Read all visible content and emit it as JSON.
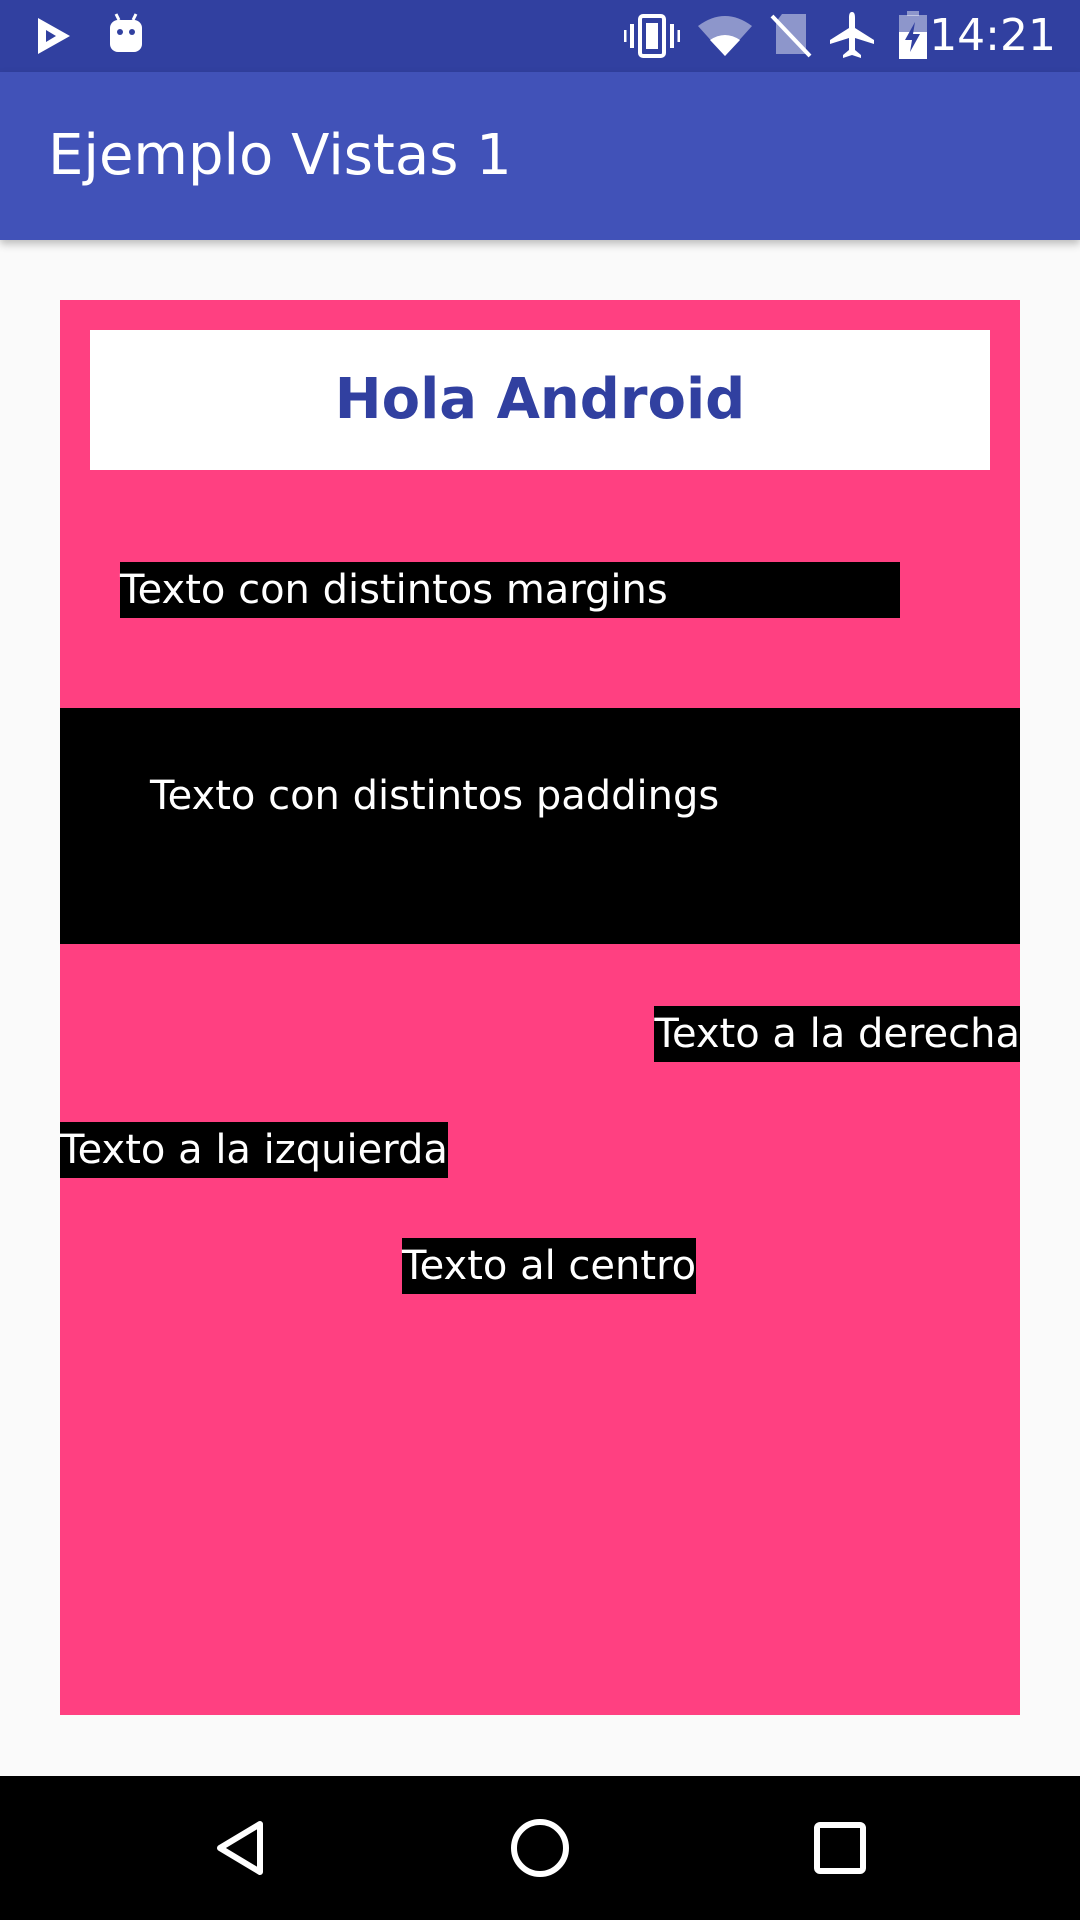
{
  "status_bar": {
    "time": "14:21",
    "background": "#3140a0",
    "icons": [
      "play-store-icon",
      "android-icon",
      "vibrate-icon",
      "wifi-icon",
      "no-sim-icon",
      "airplane-mode-icon",
      "battery-charging-icon"
    ]
  },
  "app_bar": {
    "title": "Ejemplo Vistas 1",
    "background": "#4152b8"
  },
  "main": {
    "panel_color": "#ff4081",
    "header": "Hola Android",
    "header_color": "#3140a0",
    "texts": {
      "margins": "Texto con distintos margins",
      "paddings": "Texto con distintos paddings",
      "right": "Texto a la derecha",
      "left": "Texto a la izquierda",
      "center": "Texto al centro"
    }
  },
  "nav_bar": {
    "buttons": [
      "back-icon",
      "home-icon",
      "recents-icon"
    ]
  }
}
